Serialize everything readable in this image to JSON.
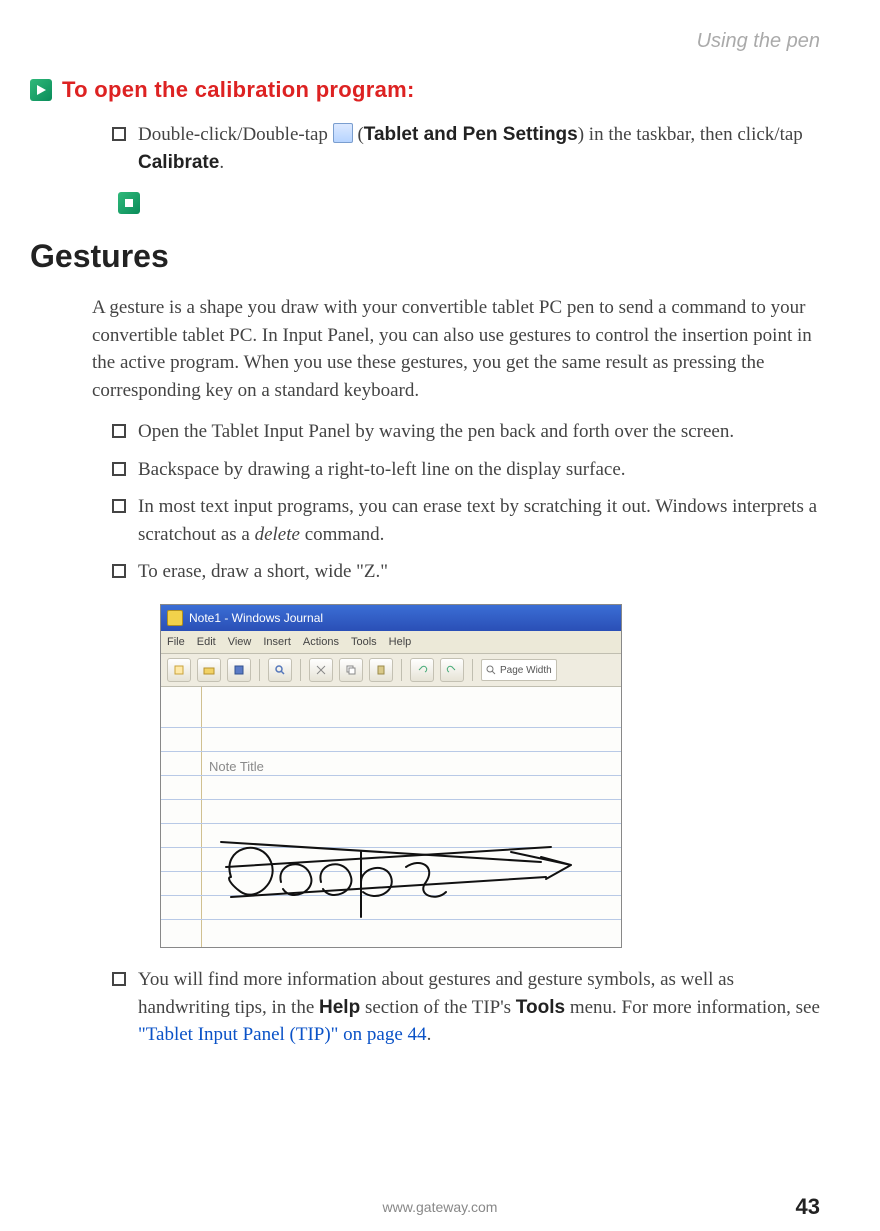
{
  "header": {
    "running_title": "Using the pen"
  },
  "procedure": {
    "heading": "To open the calibration program:",
    "step": {
      "pre": "Double-click/Double-tap ",
      "icon_alt": "tablet-settings-icon",
      "paren_open": " (",
      "bold1": "Tablet and Pen Settings",
      "mid": ") in the taskbar, then click/tap ",
      "bold2": "Calibrate",
      "post": "."
    }
  },
  "section": {
    "title": "Gestures"
  },
  "intro": "A gesture is a shape you draw with your convertible tablet PC pen to send a command to your convertible tablet PC. In Input Panel, you can also use gestures to control the insertion point in the active program. When you use these gestures, you get the same result as pressing the corresponding key on a standard keyboard.",
  "bullets": {
    "b1": "Open the Tablet Input Panel by waving the pen back and forth over the screen.",
    "b2": "Backspace by drawing a right-to-left line on the display surface.",
    "b3_pre": "In most text input programs, you can erase text by scratching it out. Windows interprets a scratchout as a ",
    "b3_italic": "delete",
    "b3_post": " command.",
    "b4": "To erase, draw a short, wide \"Z.\"",
    "b5_pre": "You will find more information about gestures and gesture symbols, as well as handwriting tips, in the ",
    "b5_bold1": "Help",
    "b5_mid": " section of the TIP's ",
    "b5_bold2": "Tools",
    "b5_post": " menu. For more information, see ",
    "b5_link": "\"Tablet Input Panel (TIP)\" on page 44",
    "b5_end": "."
  },
  "screenshot": {
    "title": "Note1 - Windows Journal",
    "menus": [
      "File",
      "Edit",
      "View",
      "Insert",
      "Actions",
      "Tools",
      "Help"
    ],
    "zoom_label": "Page Width",
    "note_title_placeholder": "Note Title"
  },
  "footer": {
    "url": "www.gateway.com",
    "page": "43"
  }
}
